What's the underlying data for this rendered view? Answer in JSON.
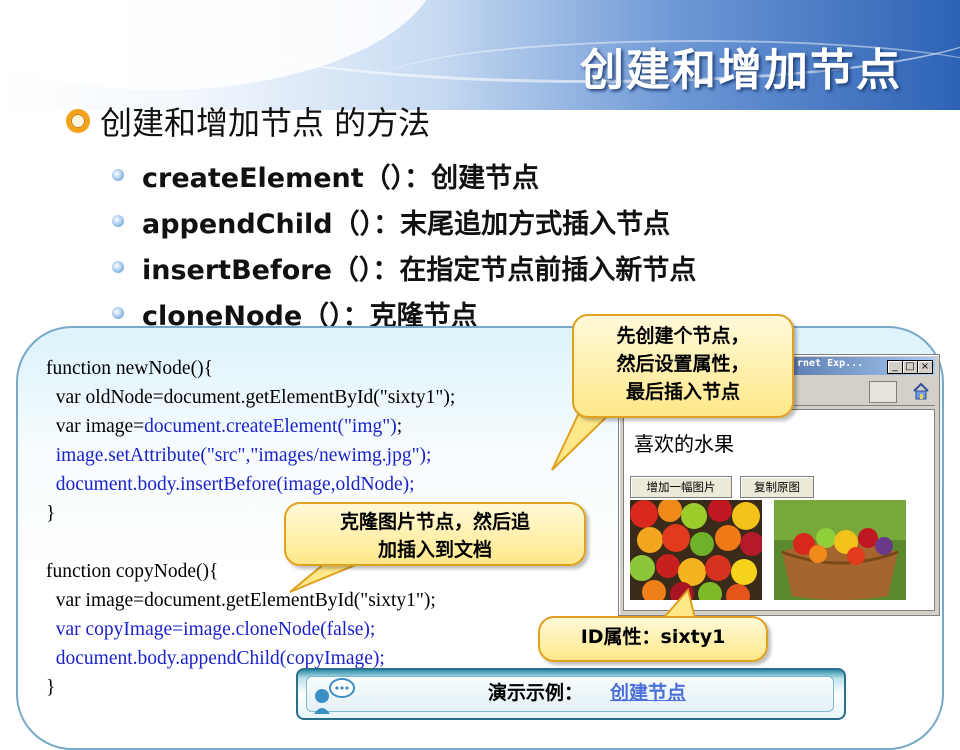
{
  "slide": {
    "title": "创建和增加节点",
    "main_point": "创建和增加节点 的方法",
    "methods": [
      {
        "name": "createElement（）：创建节点"
      },
      {
        "name": "appendChild（）：末尾追加方式插入节点"
      },
      {
        "name": "insertBefore（）：在指定节点前插入新节点"
      },
      {
        "name": "cloneNode（）：克隆节点"
      }
    ]
  },
  "code": {
    "lines": [
      {
        "text": "function newNode(){",
        "color": "#000000"
      },
      {
        "text": "  var oldNode=document.getElementById(\"sixty1\");",
        "color": "#000000"
      },
      {
        "text_a": "  var image=",
        "text_b": "document.createElement(\"img\")",
        "text_c": ";"
      },
      {
        "text": "  image.setAttribute(\"src\",\"images/newimg.jpg\");",
        "color": "#1a22c8"
      },
      {
        "text": "  document.body.insertBefore(image,oldNode);",
        "color": "#1a22c8"
      },
      {
        "text": "}",
        "color": "#000000"
      },
      {
        "text": "",
        "color": "#000000"
      },
      {
        "text": "function copyNode(){",
        "color": "#000000"
      },
      {
        "text": "  var image=document.getElementById(\"sixty1\");",
        "color": "#000000"
      },
      {
        "text": "  var copyImage=image.cloneNode(false);",
        "color": "#1a22c8"
      },
      {
        "text": "  document.body.appendChild(copyImage);",
        "color": "#1a22c8"
      },
      {
        "text": "}",
        "color": "#000000"
      }
    ]
  },
  "browser": {
    "window_title": "rnet Exp...",
    "controls": [
      "_",
      "□",
      "×"
    ],
    "page_heading": "喜欢的水果",
    "buttons": {
      "add_image": "增加一幅图片",
      "copy_original": "复制原图"
    },
    "images": [
      "fruit-pile",
      "fruit-basket"
    ]
  },
  "callouts": {
    "create_steps": [
      "先创建个节点，",
      "然后设置属性，",
      "最后插入节点"
    ],
    "clone_steps": [
      "克隆图片节点，然后追",
      "加插入到文档"
    ],
    "id_attr": "ID属性：sixty1"
  },
  "demo": {
    "label": "演示示例：",
    "link": "创建节点"
  },
  "colors": {
    "accent_orange": "#f5a21b",
    "code_blue": "#1a22c8",
    "callout_border": "#e0a020",
    "link_blue": "#4c6fd9"
  }
}
